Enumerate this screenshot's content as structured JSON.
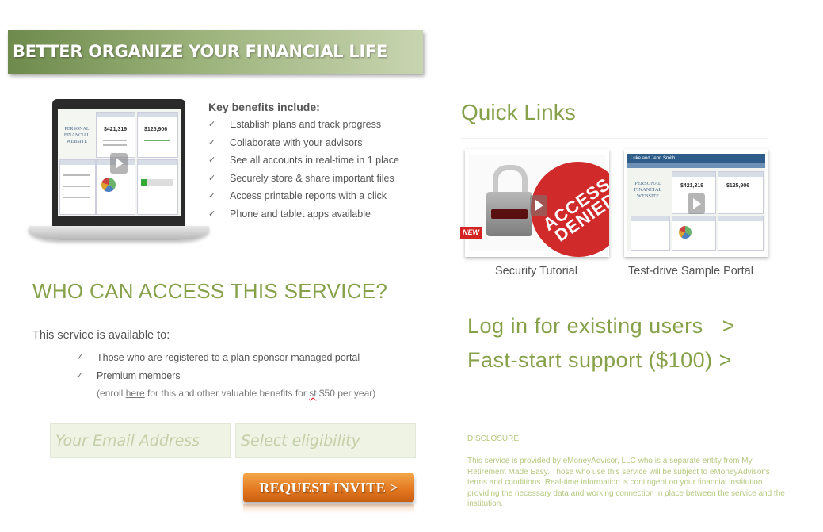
{
  "banner": {
    "title": "BETTER ORGANIZE YOUR FINANCIAL LIFE"
  },
  "laptop_screen": {
    "logo_text": "PERSONAL FINANCIAL WEBSITE",
    "net_worth": "$421,319",
    "investments": "$125,906"
  },
  "benefits": {
    "title": "Key benefits include:",
    "check_icon": "✓",
    "items": [
      "Establish plans and track progress",
      "Collaborate with your advisors",
      "See all accounts in real-time  in 1 place",
      "Securely store & share important files",
      "Access printable reports with a click",
      "Phone and tablet apps available"
    ]
  },
  "who": {
    "title": "WHO CAN ACCESS THIS SERVICE?",
    "available_text": "This service is available to:",
    "items": [
      "Those who are registered to a plan-sponsor managed portal",
      "Premium members"
    ],
    "enroll_prefix": "(enroll ",
    "enroll_link": "here",
    "enroll_mid": " for this and other valuable benefits for ",
    "enroll_typo": "st",
    "enroll_suffix": " $50 per year)"
  },
  "form": {
    "email_placeholder": "Your Email Address",
    "eligibility_placeholder": "Select eligibility",
    "request_label": "REQUEST INVITE  >"
  },
  "quick_links": {
    "title": "Quick Links",
    "new_badge": "NEW",
    "security_caption": "Security Tutorial",
    "security_stamp": "ACCESS DENIED",
    "portal_caption": "Test-drive Sample Portal",
    "portal_header": "Luke and Jenn Smith",
    "portal_net_worth": "$421,319",
    "portal_investments": "$125,906"
  },
  "links": {
    "login": "Log in for existing users   >",
    "support": "Fast-start support ($100) >"
  },
  "disclosure": {
    "title": "DISCLOSURE",
    "text": "This service is provided by eMoneyAdvisor, LLC who is a separate entity from My Retirement Made Easy. Those who use this service will be subject to eMoneyAdvisor's terms and conditions. Real-time information is contingent on your financial institution providing the necessary data and working connection in place between the service and the institution."
  },
  "colors": {
    "accent_green": "#86a14a",
    "button_orange": "#e2761f",
    "field_bg": "#eef3e3"
  }
}
